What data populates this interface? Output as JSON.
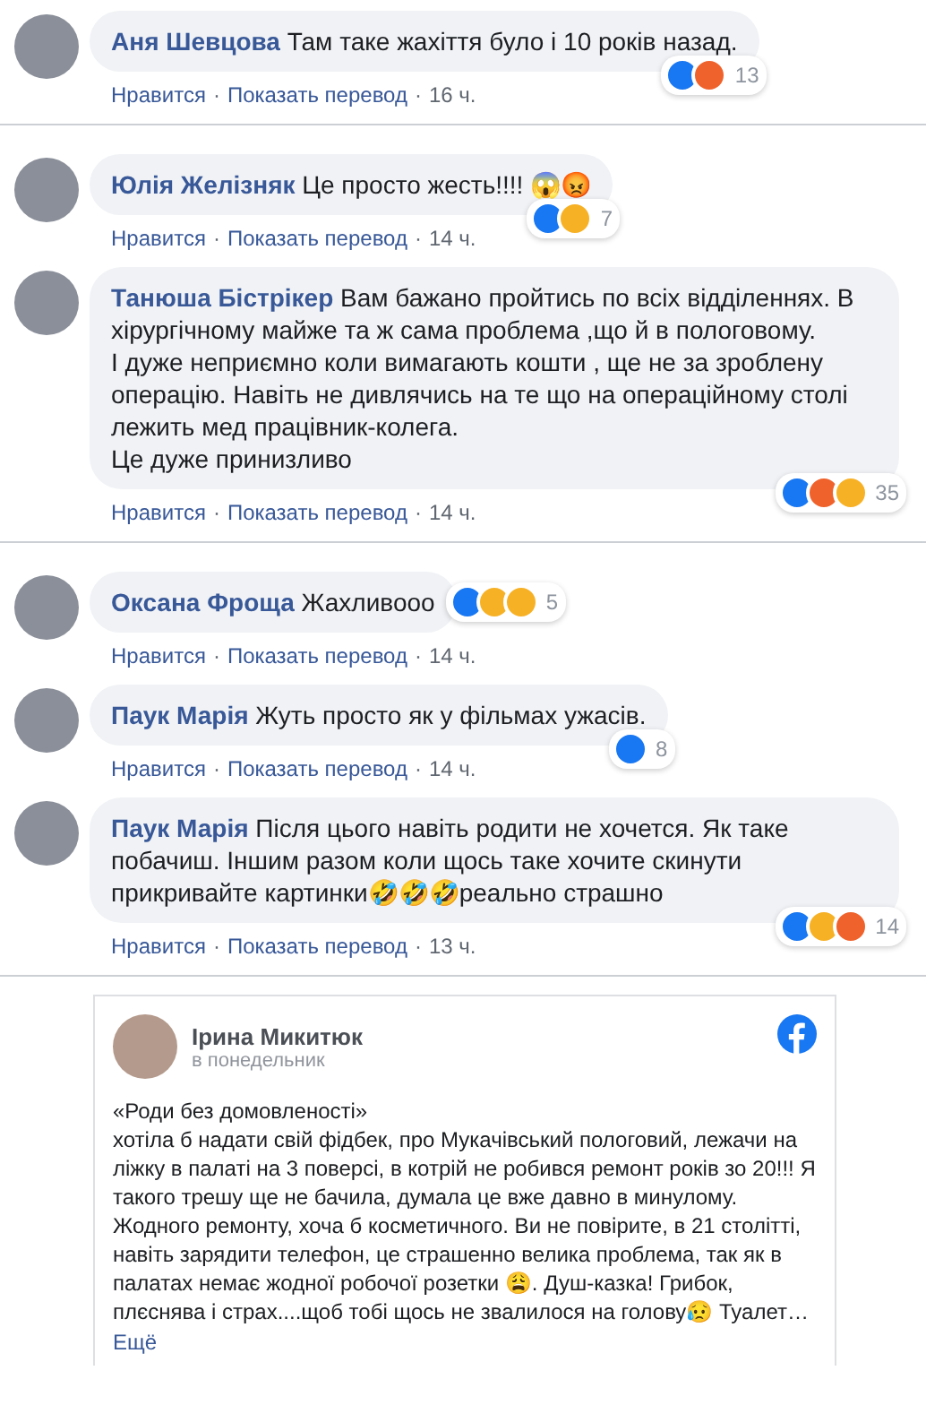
{
  "action_separator": "·",
  "comment_groups": [
    {
      "comments": [
        {
          "author": "Аня Шевцова",
          "text": "Там таке жахіття було і 10 років назад.",
          "reactions": [
            {
              "kind": "like"
            },
            {
              "kind": "angry"
            }
          ],
          "reaction_count": "13",
          "actions": [
            "Нравится",
            "Показать перевод"
          ],
          "time": "16 ч."
        }
      ]
    },
    {
      "comments": [
        {
          "author": "Юлія Желізняк",
          "text": "Це просто жесть!!!! 😱😡",
          "reactions": [
            {
              "kind": "like"
            },
            {
              "kind": "wow"
            }
          ],
          "reaction_count": "7",
          "actions": [
            "Нравится",
            "Показать перевод"
          ],
          "time": "14 ч."
        },
        {
          "author": "Танюша Бістрікер",
          "text": "Вам бажано пройтись по всіх відділеннях. В хірургічному майже та ж сама проблема ,що й в пологовому.\nІ дуже неприємно коли вимагають кошти , ще не за зроблену операцію. Навіть не дивлячись на те що на операційному столі лежить мед працівник-колега.\nЦе дуже принизливо",
          "reactions": [
            {
              "kind": "like"
            },
            {
              "kind": "angry"
            },
            {
              "kind": "sad"
            }
          ],
          "reaction_count": "35",
          "actions": [
            "Нравится",
            "Показать перевод"
          ],
          "time": "14 ч."
        }
      ]
    },
    {
      "comments": [
        {
          "author": "Оксана Фроща",
          "text": "Жахливооо",
          "reactions": [
            {
              "kind": "like"
            },
            {
              "kind": "haha"
            },
            {
              "kind": "care"
            }
          ],
          "reaction_count": "5",
          "actions": [
            "Нравится",
            "Показать перевод"
          ],
          "time": "14 ч."
        },
        {
          "author": "Паук Марія",
          "text": "Жуть просто як у фільмах ужасів.",
          "reactions": [
            {
              "kind": "like"
            }
          ],
          "reaction_count": "8",
          "actions": [
            "Нравится",
            "Показать перевод"
          ],
          "time": "14 ч."
        },
        {
          "author": "Паук Марія",
          "text": "Після цього навіть родити не хочется. Як таке побачиш. Іншим разом коли щось таке хочите скинути прикривайте картинки🤣🤣🤣реально страшно",
          "reactions": [
            {
              "kind": "like"
            },
            {
              "kind": "haha"
            },
            {
              "kind": "angry"
            }
          ],
          "reaction_count": "14",
          "actions": [
            "Нравится",
            "Показать перевод"
          ],
          "time": "13 ч."
        }
      ]
    }
  ],
  "embedded_post": {
    "author": "Ірина Микитюк",
    "date": "в понедельник",
    "title": "«Роди без домовленості»",
    "text": "хотіла б надати свій фідбек, про Мукачівський пологовий, лежачи на ліжку в палаті на 3 поверсі, в котрій не робився ремонт років зо 20!!! Я такого трешу ще не бачила, думала це вже давно в минулому. Жодного ремонту, хоча б косметичного. Ви не повірите, в 21 столітті, навіть зарядити телефон, це страшенно велика проблема, так як в палатах немає жодної робочої розетки 😩. Душ-казка! Грибок, плєснява і страх....щоб тобі щось не звалилося на голову😥 Туалет…",
    "more": "Ещё"
  }
}
